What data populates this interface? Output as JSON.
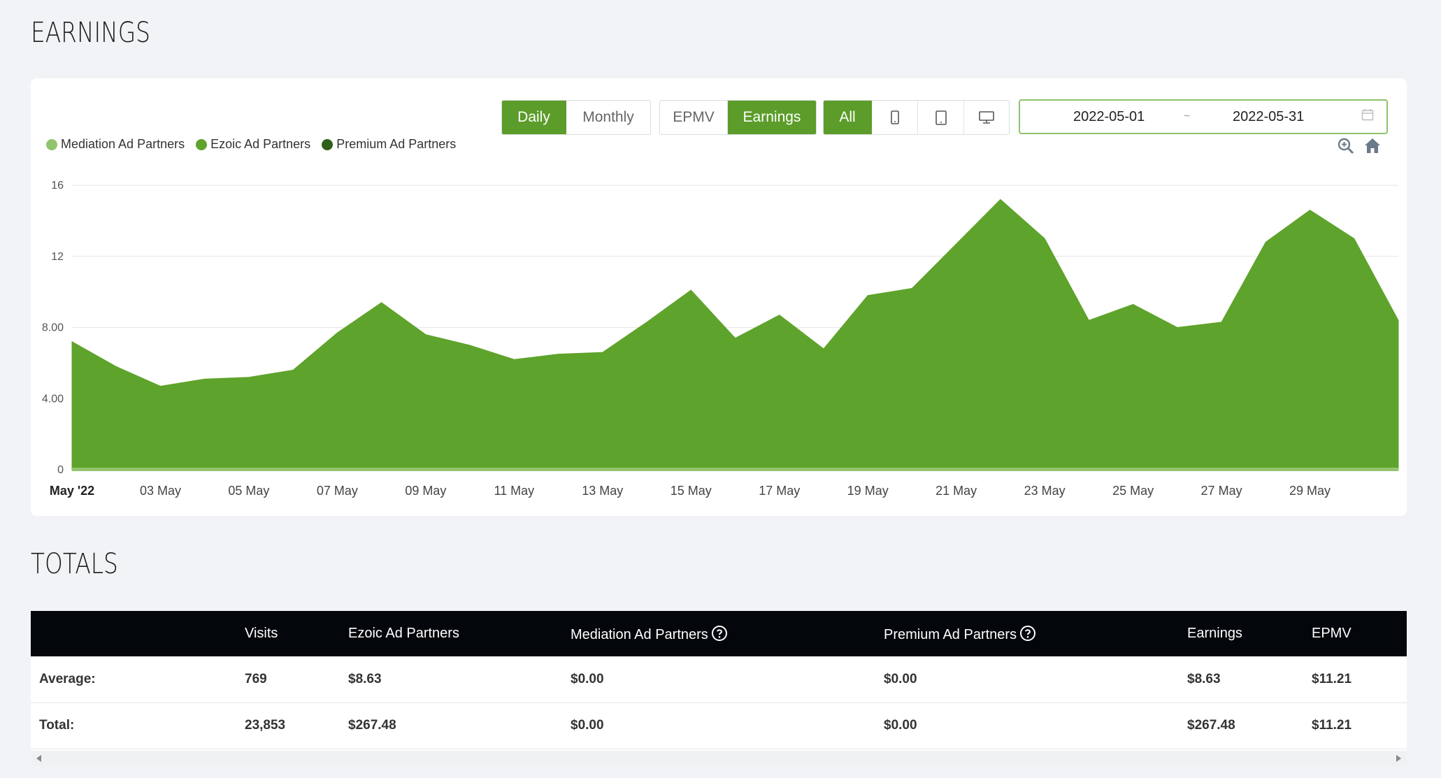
{
  "earnings": {
    "title": "EARNINGS",
    "period_buttons": [
      "Daily",
      "Monthly"
    ],
    "period_active": "Daily",
    "metric_buttons": [
      "EPMV",
      "Earnings"
    ],
    "metric_active": "Earnings",
    "device_buttons": [
      {
        "label": "All",
        "icon": "all"
      },
      {
        "label": "",
        "icon": "mobile-icon"
      },
      {
        "label": "",
        "icon": "tablet-icon"
      },
      {
        "label": "",
        "icon": "desktop-icon"
      }
    ],
    "device_active": "All",
    "date_from": "2022-05-01",
    "date_separator": "~",
    "date_to": "2022-05-31",
    "colors": {
      "accent": "#5c9c2a",
      "mediation": "#92c46e",
      "ezoic": "#5ea32b",
      "premium": "#2f5f18"
    }
  },
  "chart_data": {
    "type": "area",
    "stacked": true,
    "x": [
      "01 May",
      "02 May",
      "03 May",
      "04 May",
      "05 May",
      "06 May",
      "07 May",
      "08 May",
      "09 May",
      "10 May",
      "11 May",
      "12 May",
      "13 May",
      "14 May",
      "15 May",
      "16 May",
      "17 May",
      "18 May",
      "19 May",
      "20 May",
      "21 May",
      "22 May",
      "23 May",
      "24 May",
      "25 May",
      "26 May",
      "27 May",
      "28 May",
      "29 May",
      "30 May",
      "31 May"
    ],
    "x_tick_labels": [
      "May '22",
      "03 May",
      "05 May",
      "07 May",
      "09 May",
      "11 May",
      "13 May",
      "15 May",
      "17 May",
      "19 May",
      "21 May",
      "23 May",
      "25 May",
      "27 May",
      "29 May"
    ],
    "series": [
      {
        "name": "Mediation Ad Partners",
        "color": "#92c46e",
        "values": [
          0,
          0,
          0,
          0,
          0,
          0,
          0,
          0,
          0,
          0,
          0,
          0,
          0,
          0,
          0,
          0,
          0,
          0,
          0,
          0,
          0,
          0,
          0,
          0,
          0,
          0,
          0,
          0,
          0,
          0,
          0
        ]
      },
      {
        "name": "Ezoic Ad Partners",
        "color": "#5ea32b",
        "values": [
          7.2,
          5.8,
          4.7,
          5.1,
          5.2,
          5.6,
          7.7,
          9.4,
          7.6,
          7.0,
          6.2,
          6.5,
          6.6,
          8.3,
          10.1,
          7.4,
          8.7,
          6.8,
          9.8,
          10.2,
          12.7,
          15.2,
          13.0,
          8.4,
          9.3,
          8.0,
          8.3,
          12.8,
          14.6,
          13.0,
          8.4
        ]
      },
      {
        "name": "Premium Ad Partners",
        "color": "#2f5f18",
        "values": [
          0,
          0,
          0,
          0,
          0,
          0,
          0,
          0,
          0,
          0,
          0,
          0,
          0,
          0,
          0,
          0,
          0,
          0,
          0,
          0,
          0,
          0,
          0,
          0,
          0,
          0,
          0,
          0,
          0,
          0,
          0
        ]
      }
    ],
    "y_ticks": [
      "0",
      "4.00",
      "8.00",
      "12",
      "16"
    ],
    "y_tick_values": [
      0,
      4,
      8,
      12,
      16
    ],
    "ylim": [
      0,
      16
    ],
    "grid": true,
    "legend_position": "top-left"
  },
  "totals": {
    "title": "TOTALS",
    "headers": [
      "",
      "Visits",
      "Ezoic Ad Partners",
      "Mediation Ad Partners",
      "Premium Ad Partners",
      "Earnings",
      "EPMV"
    ],
    "rows": [
      {
        "label": "Average:",
        "visits": "769",
        "ezoic": "$8.63",
        "mediation": "$0.00",
        "premium": "$0.00",
        "earnings": "$8.63",
        "epmv": "$11.21"
      },
      {
        "label": "Total:",
        "visits": "23,853",
        "ezoic": "$267.48",
        "mediation": "$0.00",
        "premium": "$0.00",
        "earnings": "$267.48",
        "epmv": "$11.21"
      }
    ]
  }
}
